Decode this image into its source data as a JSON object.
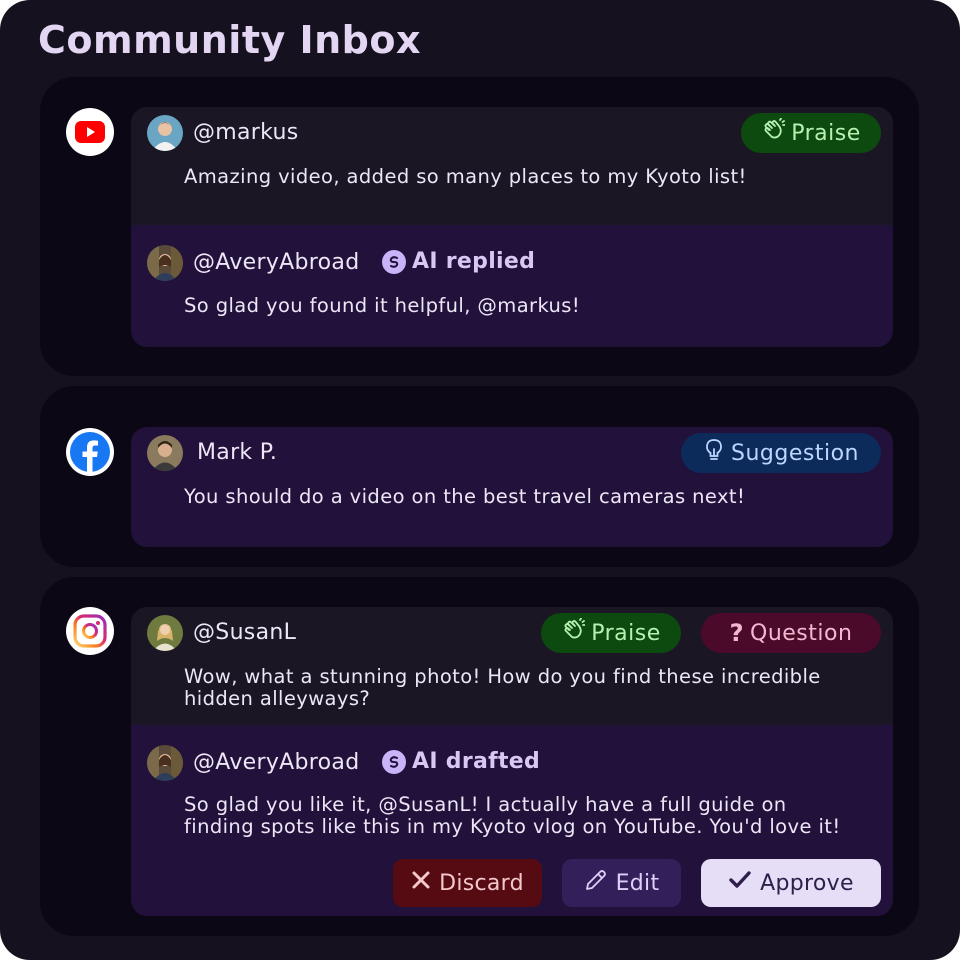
{
  "header": {
    "title": "Community Inbox"
  },
  "threads": [
    {
      "platform": "YouTube",
      "comment": {
        "author": "@markus",
        "text": "Amazing video, added so many places to my Kyoto list!",
        "tags": [
          "Praise"
        ]
      },
      "reply": {
        "author": "@AveryAbroad",
        "status": "AI replied",
        "text": "So glad you found it helpful, @markus!"
      }
    },
    {
      "platform": "Facebook",
      "comment": {
        "author": "Mark P.",
        "text": "You should do a video on the best travel cameras next!",
        "tags": [
          "Suggestion"
        ]
      }
    },
    {
      "platform": "Instagram",
      "comment": {
        "author": "@SusanL",
        "text_lines": [
          "Wow, what a stunning photo! How do you find these incredible",
          "hidden alleyways?"
        ],
        "tags": [
          "Praise",
          "Question"
        ]
      },
      "reply": {
        "author": "@AveryAbroad",
        "status": "AI drafted",
        "text_lines": [
          "So glad you like it, @SusanL! I actually have a full guide on",
          "finding spots like this in my Kyoto vlog on YouTube. You'd love it!"
        ],
        "actions": {
          "discard": "Discard",
          "edit": "Edit",
          "approve": "Approve"
        }
      }
    }
  ],
  "colors": {
    "background": "#16111f",
    "card": "#0c0714",
    "comment_panel": "#1a1624",
    "reply_panel": "#22113a",
    "praise": "#0d4a10",
    "suggestion": "#0c2a5a",
    "question": "#4c0a2a"
  },
  "icons": [
    "youtube-icon",
    "facebook-icon",
    "instagram-icon",
    "clap-icon",
    "lightbulb-icon",
    "question-icon",
    "ai-spark-icon",
    "close-icon",
    "pencil-icon",
    "check-icon"
  ]
}
